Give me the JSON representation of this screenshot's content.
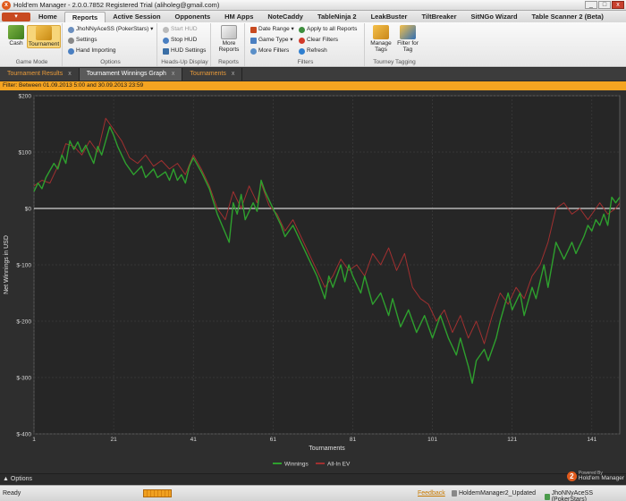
{
  "window": {
    "title": "Hold'em Manager - 2.0.0.7852 Registered Trial (aliholeg@gmail.com)",
    "close": "x",
    "minimize": "_",
    "maximize": "□"
  },
  "menu": {
    "app_button": "▾",
    "tabs": [
      {
        "label": "Home"
      },
      {
        "label": "Reports"
      },
      {
        "label": "Active Session"
      },
      {
        "label": "Opponents"
      },
      {
        "label": "HM Apps"
      },
      {
        "label": "NoteCaddy"
      },
      {
        "label": "TableNinja 2"
      },
      {
        "label": "LeakBuster"
      },
      {
        "label": "TiltBreaker"
      },
      {
        "label": "SitNGo Wizard"
      },
      {
        "label": "Table Scanner 2 (Beta)"
      }
    ]
  },
  "ribbon": {
    "game_mode": {
      "label": "Game Mode",
      "cash": "Cash",
      "tournament": "Tournament"
    },
    "options": {
      "label": "Options",
      "player": "JhoNNyAceSS (PokerStars)",
      "settings": "Settings",
      "hand_importing": "Hand Importing"
    },
    "hud": {
      "label": "Heads-Up Display",
      "start": "Start HUD",
      "stop": "Stop HUD",
      "settings": "HUD Settings"
    },
    "reports": {
      "label": "Reports",
      "more": "More Reports"
    },
    "filters": {
      "label": "Filters",
      "date_range": "Date Range",
      "game_type": "Game Type",
      "more_filters": "More Filters",
      "apply_all": "Apply to all Reports",
      "clear": "Clear Filters",
      "refresh": "Refresh"
    },
    "tagging": {
      "label": "Tourney Tagging",
      "manage": "Manage Tags",
      "filter": "Filter for Tag"
    }
  },
  "doctabs": [
    {
      "label": "Tournament Results",
      "close": "x"
    },
    {
      "label": "Tournament Winnings Graph",
      "close": "x"
    },
    {
      "label": "Tournaments",
      "close": "x"
    }
  ],
  "filter_text": "Filter: Between 01.09.2013 5:00 and 30.09.2013 23:59",
  "chart_data": {
    "type": "line",
    "xlabel": "Tournaments",
    "ylabel": "Net Winnings in USD",
    "xlim": [
      1,
      148
    ],
    "ylim": [
      -400,
      200
    ],
    "x_ticks": [
      "1",
      "21",
      "41",
      "61",
      "81",
      "101",
      "121",
      "141"
    ],
    "y_ticks": [
      "$200",
      "$100",
      "$0",
      "$-100",
      "$-200",
      "$-300",
      "$-400"
    ],
    "grid": true,
    "legend": "bottom-center",
    "series": [
      {
        "name": "Winnings",
        "color": "#2ea02e",
        "points": [
          [
            1,
            30
          ],
          [
            2,
            45
          ],
          [
            3,
            35
          ],
          [
            4,
            55
          ],
          [
            6,
            80
          ],
          [
            7,
            70
          ],
          [
            8,
            95
          ],
          [
            9,
            80
          ],
          [
            10,
            120
          ],
          [
            11,
            105
          ],
          [
            12,
            118
          ],
          [
            13,
            100
          ],
          [
            14,
            112
          ],
          [
            15,
            95
          ],
          [
            16,
            80
          ],
          [
            17,
            110
          ],
          [
            18,
            95
          ],
          [
            20,
            145
          ],
          [
            21,
            130
          ],
          [
            22,
            110
          ],
          [
            23,
            95
          ],
          [
            24,
            80
          ],
          [
            26,
            60
          ],
          [
            28,
            75
          ],
          [
            29,
            55
          ],
          [
            31,
            70
          ],
          [
            32,
            55
          ],
          [
            34,
            65
          ],
          [
            35,
            50
          ],
          [
            36,
            70
          ],
          [
            37,
            50
          ],
          [
            38,
            60
          ],
          [
            39,
            45
          ],
          [
            40,
            75
          ],
          [
            41,
            90
          ],
          [
            43,
            65
          ],
          [
            45,
            35
          ],
          [
            47,
            -10
          ],
          [
            50,
            -60
          ],
          [
            51,
            10
          ],
          [
            52,
            -10
          ],
          [
            53,
            25
          ],
          [
            54,
            -20
          ],
          [
            56,
            10
          ],
          [
            57,
            -5
          ],
          [
            58,
            50
          ],
          [
            59,
            30
          ],
          [
            61,
            0
          ],
          [
            63,
            -30
          ],
          [
            64,
            -50
          ],
          [
            66,
            -30
          ],
          [
            68,
            -60
          ],
          [
            70,
            -90
          ],
          [
            72,
            -120
          ],
          [
            74,
            -160
          ],
          [
            75,
            -120
          ],
          [
            76,
            -140
          ],
          [
            78,
            -100
          ],
          [
            79,
            -130
          ],
          [
            80,
            -100
          ],
          [
            81,
            -120
          ],
          [
            83,
            -150
          ],
          [
            84,
            -120
          ],
          [
            86,
            -170
          ],
          [
            88,
            -150
          ],
          [
            90,
            -190
          ],
          [
            91,
            -160
          ],
          [
            93,
            -210
          ],
          [
            95,
            -180
          ],
          [
            97,
            -220
          ],
          [
            99,
            -190
          ],
          [
            101,
            -230
          ],
          [
            103,
            -190
          ],
          [
            105,
            -230
          ],
          [
            107,
            -260
          ],
          [
            108,
            -230
          ],
          [
            110,
            -280
          ],
          [
            111,
            -310
          ],
          [
            112,
            -270
          ],
          [
            114,
            -250
          ],
          [
            115,
            -270
          ],
          [
            117,
            -230
          ],
          [
            118,
            -200
          ],
          [
            120,
            -150
          ],
          [
            121,
            -180
          ],
          [
            123,
            -150
          ],
          [
            124,
            -190
          ],
          [
            126,
            -140
          ],
          [
            127,
            -160
          ],
          [
            129,
            -100
          ],
          [
            130,
            -140
          ],
          [
            132,
            -60
          ],
          [
            134,
            -90
          ],
          [
            136,
            -60
          ],
          [
            137,
            -80
          ],
          [
            139,
            -50
          ],
          [
            140,
            -30
          ],
          [
            141,
            -40
          ],
          [
            142,
            -20
          ],
          [
            143,
            -30
          ],
          [
            144,
            -10
          ],
          [
            145,
            -30
          ],
          [
            146,
            20
          ],
          [
            147,
            10
          ],
          [
            148,
            20
          ]
        ]
      },
      {
        "name": "All-In EV",
        "color": "#a03030",
        "points": [
          [
            1,
            40
          ],
          [
            3,
            50
          ],
          [
            5,
            45
          ],
          [
            7,
            75
          ],
          [
            9,
            115
          ],
          [
            11,
            110
          ],
          [
            13,
            95
          ],
          [
            15,
            120
          ],
          [
            17,
            100
          ],
          [
            19,
            160
          ],
          [
            20,
            150
          ],
          [
            21,
            140
          ],
          [
            23,
            120
          ],
          [
            25,
            90
          ],
          [
            27,
            80
          ],
          [
            29,
            95
          ],
          [
            31,
            75
          ],
          [
            33,
            85
          ],
          [
            35,
            70
          ],
          [
            37,
            80
          ],
          [
            39,
            60
          ],
          [
            41,
            95
          ],
          [
            43,
            70
          ],
          [
            45,
            40
          ],
          [
            47,
            0
          ],
          [
            49,
            -20
          ],
          [
            51,
            30
          ],
          [
            53,
            0
          ],
          [
            55,
            40
          ],
          [
            57,
            10
          ],
          [
            58,
            45
          ],
          [
            60,
            5
          ],
          [
            62,
            -10
          ],
          [
            64,
            -40
          ],
          [
            66,
            -20
          ],
          [
            68,
            -50
          ],
          [
            70,
            -80
          ],
          [
            72,
            -110
          ],
          [
            74,
            -140
          ],
          [
            76,
            -120
          ],
          [
            78,
            -90
          ],
          [
            80,
            -110
          ],
          [
            82,
            -100
          ],
          [
            84,
            -120
          ],
          [
            86,
            -80
          ],
          [
            88,
            -100
          ],
          [
            90,
            -70
          ],
          [
            92,
            -110
          ],
          [
            94,
            -80
          ],
          [
            96,
            -140
          ],
          [
            98,
            -160
          ],
          [
            100,
            -170
          ],
          [
            102,
            -200
          ],
          [
            104,
            -180
          ],
          [
            106,
            -220
          ],
          [
            108,
            -190
          ],
          [
            110,
            -230
          ],
          [
            112,
            -200
          ],
          [
            114,
            -240
          ],
          [
            116,
            -190
          ],
          [
            118,
            -150
          ],
          [
            120,
            -170
          ],
          [
            122,
            -140
          ],
          [
            124,
            -160
          ],
          [
            126,
            -120
          ],
          [
            128,
            -100
          ],
          [
            130,
            -60
          ],
          [
            132,
            0
          ],
          [
            134,
            10
          ],
          [
            136,
            -10
          ],
          [
            138,
            0
          ],
          [
            140,
            -20
          ],
          [
            142,
            0
          ],
          [
            143,
            10
          ],
          [
            145,
            -10
          ],
          [
            147,
            0
          ],
          [
            148,
            10
          ]
        ]
      }
    ],
    "zero_line": true
  },
  "footer": {
    "options": "Options",
    "powered_by": "Powered By",
    "brand": "Hold'em Manager"
  },
  "status": {
    "ready": "Ready",
    "feedback": "Feedback",
    "update": "HoldemManager2_Updated",
    "player": "JhoNNyAceSS (PokerStars)"
  }
}
